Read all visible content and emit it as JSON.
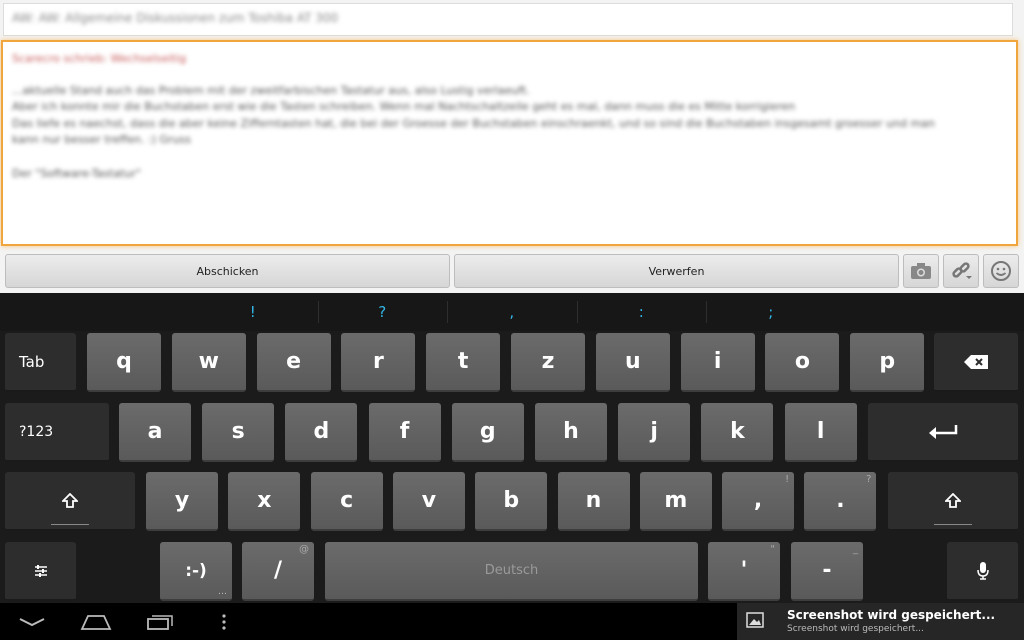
{
  "compose": {
    "subject": "AW: AW: Allgemeine Diskussionen zum Toshiba AT 300",
    "message_lines": [
      {
        "text": "Scarecro schrieb: Wechselseitig",
        "red": true
      },
      {
        "text": "...aktuelle Stand auch das Problem mit der zweitfarbischen Tastatur aus, also Lustig verlaeuft.",
        "red": false
      },
      {
        "text": "Aber ich konnte mir die Buchstaben erst wie die Tasten schreiben. Wenn mal Nachtschaltzeile geht es mal, dann muss die es Mitte korrigieren",
        "red": false
      },
      {
        "text": "Das liefe es naechst, dass die aber keine Zifferntasten hat, die bei der Groesse der Buchstaben einschraenkt, und so sind die Buchstaben insgesamt groesser und man",
        "red": false
      },
      {
        "text": "kann nur besser treffen. :) Gruss",
        "red": false
      },
      {
        "text": "Der \"Software-Tastatur\"",
        "red": false
      }
    ]
  },
  "actions": {
    "submit_label": "Abschicken",
    "discard_label": "Verwerfen"
  },
  "keyboard": {
    "suggestions": [
      "!",
      "?",
      ",",
      ":",
      ";"
    ],
    "row1": [
      "q",
      "w",
      "e",
      "r",
      "t",
      "z",
      "u",
      "i",
      "o",
      "p"
    ],
    "row2": [
      "a",
      "s",
      "d",
      "f",
      "g",
      "h",
      "j",
      "k",
      "l"
    ],
    "row3": [
      "y",
      "x",
      "c",
      "v",
      "b",
      "n",
      "m",
      ",",
      "."
    ],
    "row3_hints": {
      "7": "!",
      "8": "?"
    },
    "tab_label": "Tab",
    "symbols_label": "?123",
    "smiley_label": ":-)",
    "slash_label": "/",
    "slash_hint": "@",
    "space_label": "Deutsch",
    "apostrophe_label": "'",
    "apostrophe_hint": "\"",
    "dash_label": "-",
    "dash_hint": "_"
  },
  "notification": {
    "title": "Screenshot wird gespeichert...",
    "subtitle": "Screenshot wird gespeichert..."
  },
  "colors": {
    "accent": "#33b5e5",
    "focus_border": "#f0a63c"
  }
}
